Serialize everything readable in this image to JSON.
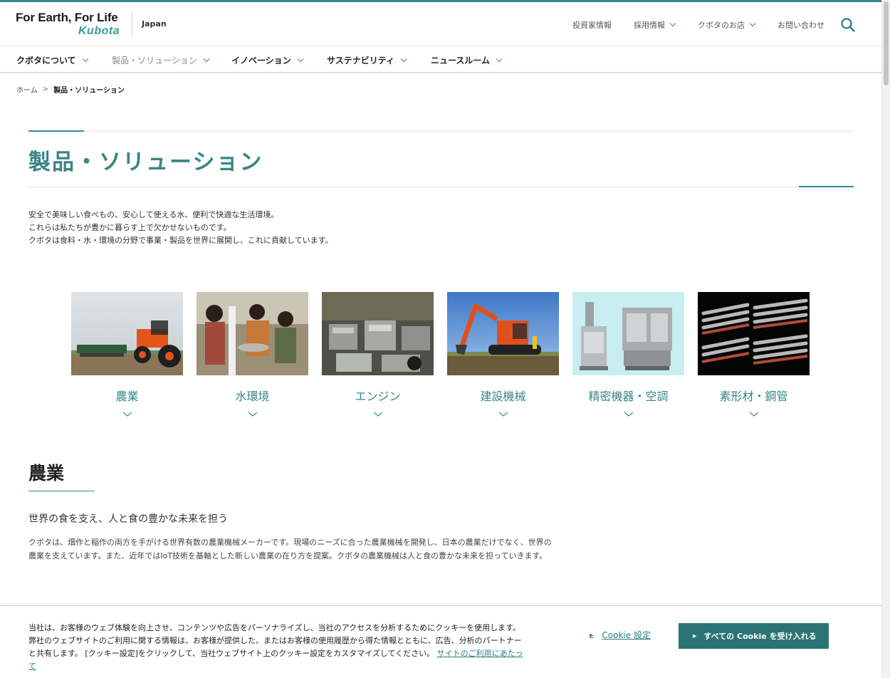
{
  "header": {
    "logo_tagline": "For Earth, For Life",
    "logo_brand": "Kubota",
    "region": "Japan",
    "utility_links": [
      {
        "label": "投資家情報",
        "has_dropdown": false
      },
      {
        "label": "採用情報",
        "has_dropdown": true
      },
      {
        "label": "クボタのお店",
        "has_dropdown": true
      },
      {
        "label": "お問い合わせ",
        "has_dropdown": false
      }
    ],
    "search_icon": "search-icon"
  },
  "nav": {
    "items": [
      {
        "label": "クボタについて",
        "active": false
      },
      {
        "label": "製品・ソリューション",
        "active": true
      },
      {
        "label": "イノベーション",
        "active": false
      },
      {
        "label": "サステナビリティ",
        "active": false
      },
      {
        "label": "ニュースルーム",
        "active": false
      }
    ]
  },
  "breadcrumb": {
    "home": "ホーム",
    "separator": ">",
    "current": "製品・ソリューション"
  },
  "page": {
    "title": "製品・ソリューション",
    "intro_lines": [
      "安全で美味しい食べもの、安心して使える水、便利で快適な生活環境。",
      "これらは私たちが豊かに暮らす上で欠かせないものです。",
      "クボタは食料・水・環境の分野で事業・製品を世界に展開し、これに貢献しています。"
    ]
  },
  "categories": [
    {
      "label": "農業",
      "image": "tractor-photo"
    },
    {
      "label": "水環境",
      "image": "children-water-photo"
    },
    {
      "label": "エンジン",
      "image": "engine-factory-photo"
    },
    {
      "label": "建設機械",
      "image": "excavator-photo"
    },
    {
      "label": "精密機器・空調",
      "image": "precision-equipment-photo"
    },
    {
      "label": "素形材・鋼管",
      "image": "steel-pipes-photo"
    }
  ],
  "section": {
    "title": "農業",
    "subtitle": "世界の食を支え、人と食の豊かな未来を担う",
    "body": "クボタは、畑作と稲作の両方を手がける世界有数の農業機械メーカーです。現場のニーズに合った農業機械を開発し、日本の農業だけでなく、世界の農業を支えています。また、近年ではIoT技術を基軸とした新しい農業の在り方を提案。クボタの農業機械は人と食の豊かな未来を担っていきます。"
  },
  "cookie": {
    "text": "当社は、お客様のウェブ体験を向上させ、コンテンツや広告をパーソナライズし、当社のアクセスを分析するためにクッキーを使用します。弊社のウェブサイトのご利用に関する情報は、お客様が提供した、またはお客様の使用履歴から得た情報とともに、広告、分析のパートナーと共有します。 [クッキー設定]をクリックして、当社ウェブサイト上のクッキー設定をカスタマイズしてください。",
    "policy_link": "サイトのご利用にあたって",
    "settings_label": "Cookie 設定",
    "accept_label": "すべての Cookie を受け入れる"
  },
  "colors": {
    "accent": "#3b8a8a",
    "button": "#2b7475"
  }
}
